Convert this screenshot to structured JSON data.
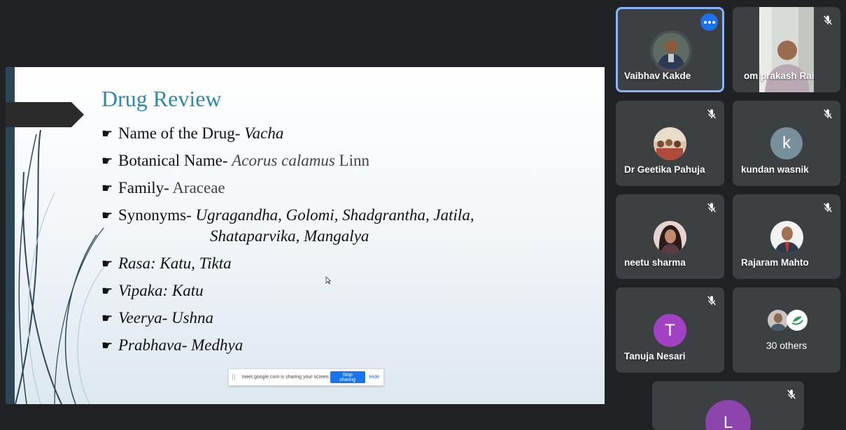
{
  "slide": {
    "title": "Drug Review",
    "bullet_glyph": "☛",
    "bullets": [
      {
        "label": "Name of the Drug- ",
        "value": "Vacha"
      },
      {
        "label": "Botanical Name- ",
        "value": "Acorus calamus",
        "suffix": " Linn"
      },
      {
        "label": "Family- ",
        "value": "Araceae"
      },
      {
        "label": "Synonyms- ",
        "value": "Ugragandha, Golomi, Shadgrantha, Jatila,",
        "cont": "Shataparvika, Mangalya"
      },
      {
        "value": "Rasa: Katu, Tikta"
      },
      {
        "value": "Vipaka: Katu"
      },
      {
        "value": "Veerya- Ushna"
      },
      {
        "value": "Prabhava- Medhya"
      }
    ]
  },
  "share_bar": {
    "message": "meet.google.com is sharing your screen.",
    "stop_label": "Stop sharing",
    "hide_label": "Hide"
  },
  "participants": [
    {
      "name": "Vaibhav Kakde",
      "active": true
    },
    {
      "name": "om prakash Rai"
    },
    {
      "name": "Dr Geetika Pahuja"
    },
    {
      "name": "kundan wasnik",
      "initial": "k",
      "color": "#78909c"
    },
    {
      "name": "neetu sharma"
    },
    {
      "name": "Rajaram Mahto"
    },
    {
      "name": "Tanuja Nesari",
      "initial": "T",
      "color": "#a142c4"
    },
    {
      "initial": "L",
      "color": "#8e44ad"
    }
  ],
  "others": {
    "label": "30 others"
  },
  "colors": {
    "background": "#202124",
    "tile": "#3c4043",
    "active_border": "#8ab4f8",
    "accent": "#1a73e8"
  }
}
